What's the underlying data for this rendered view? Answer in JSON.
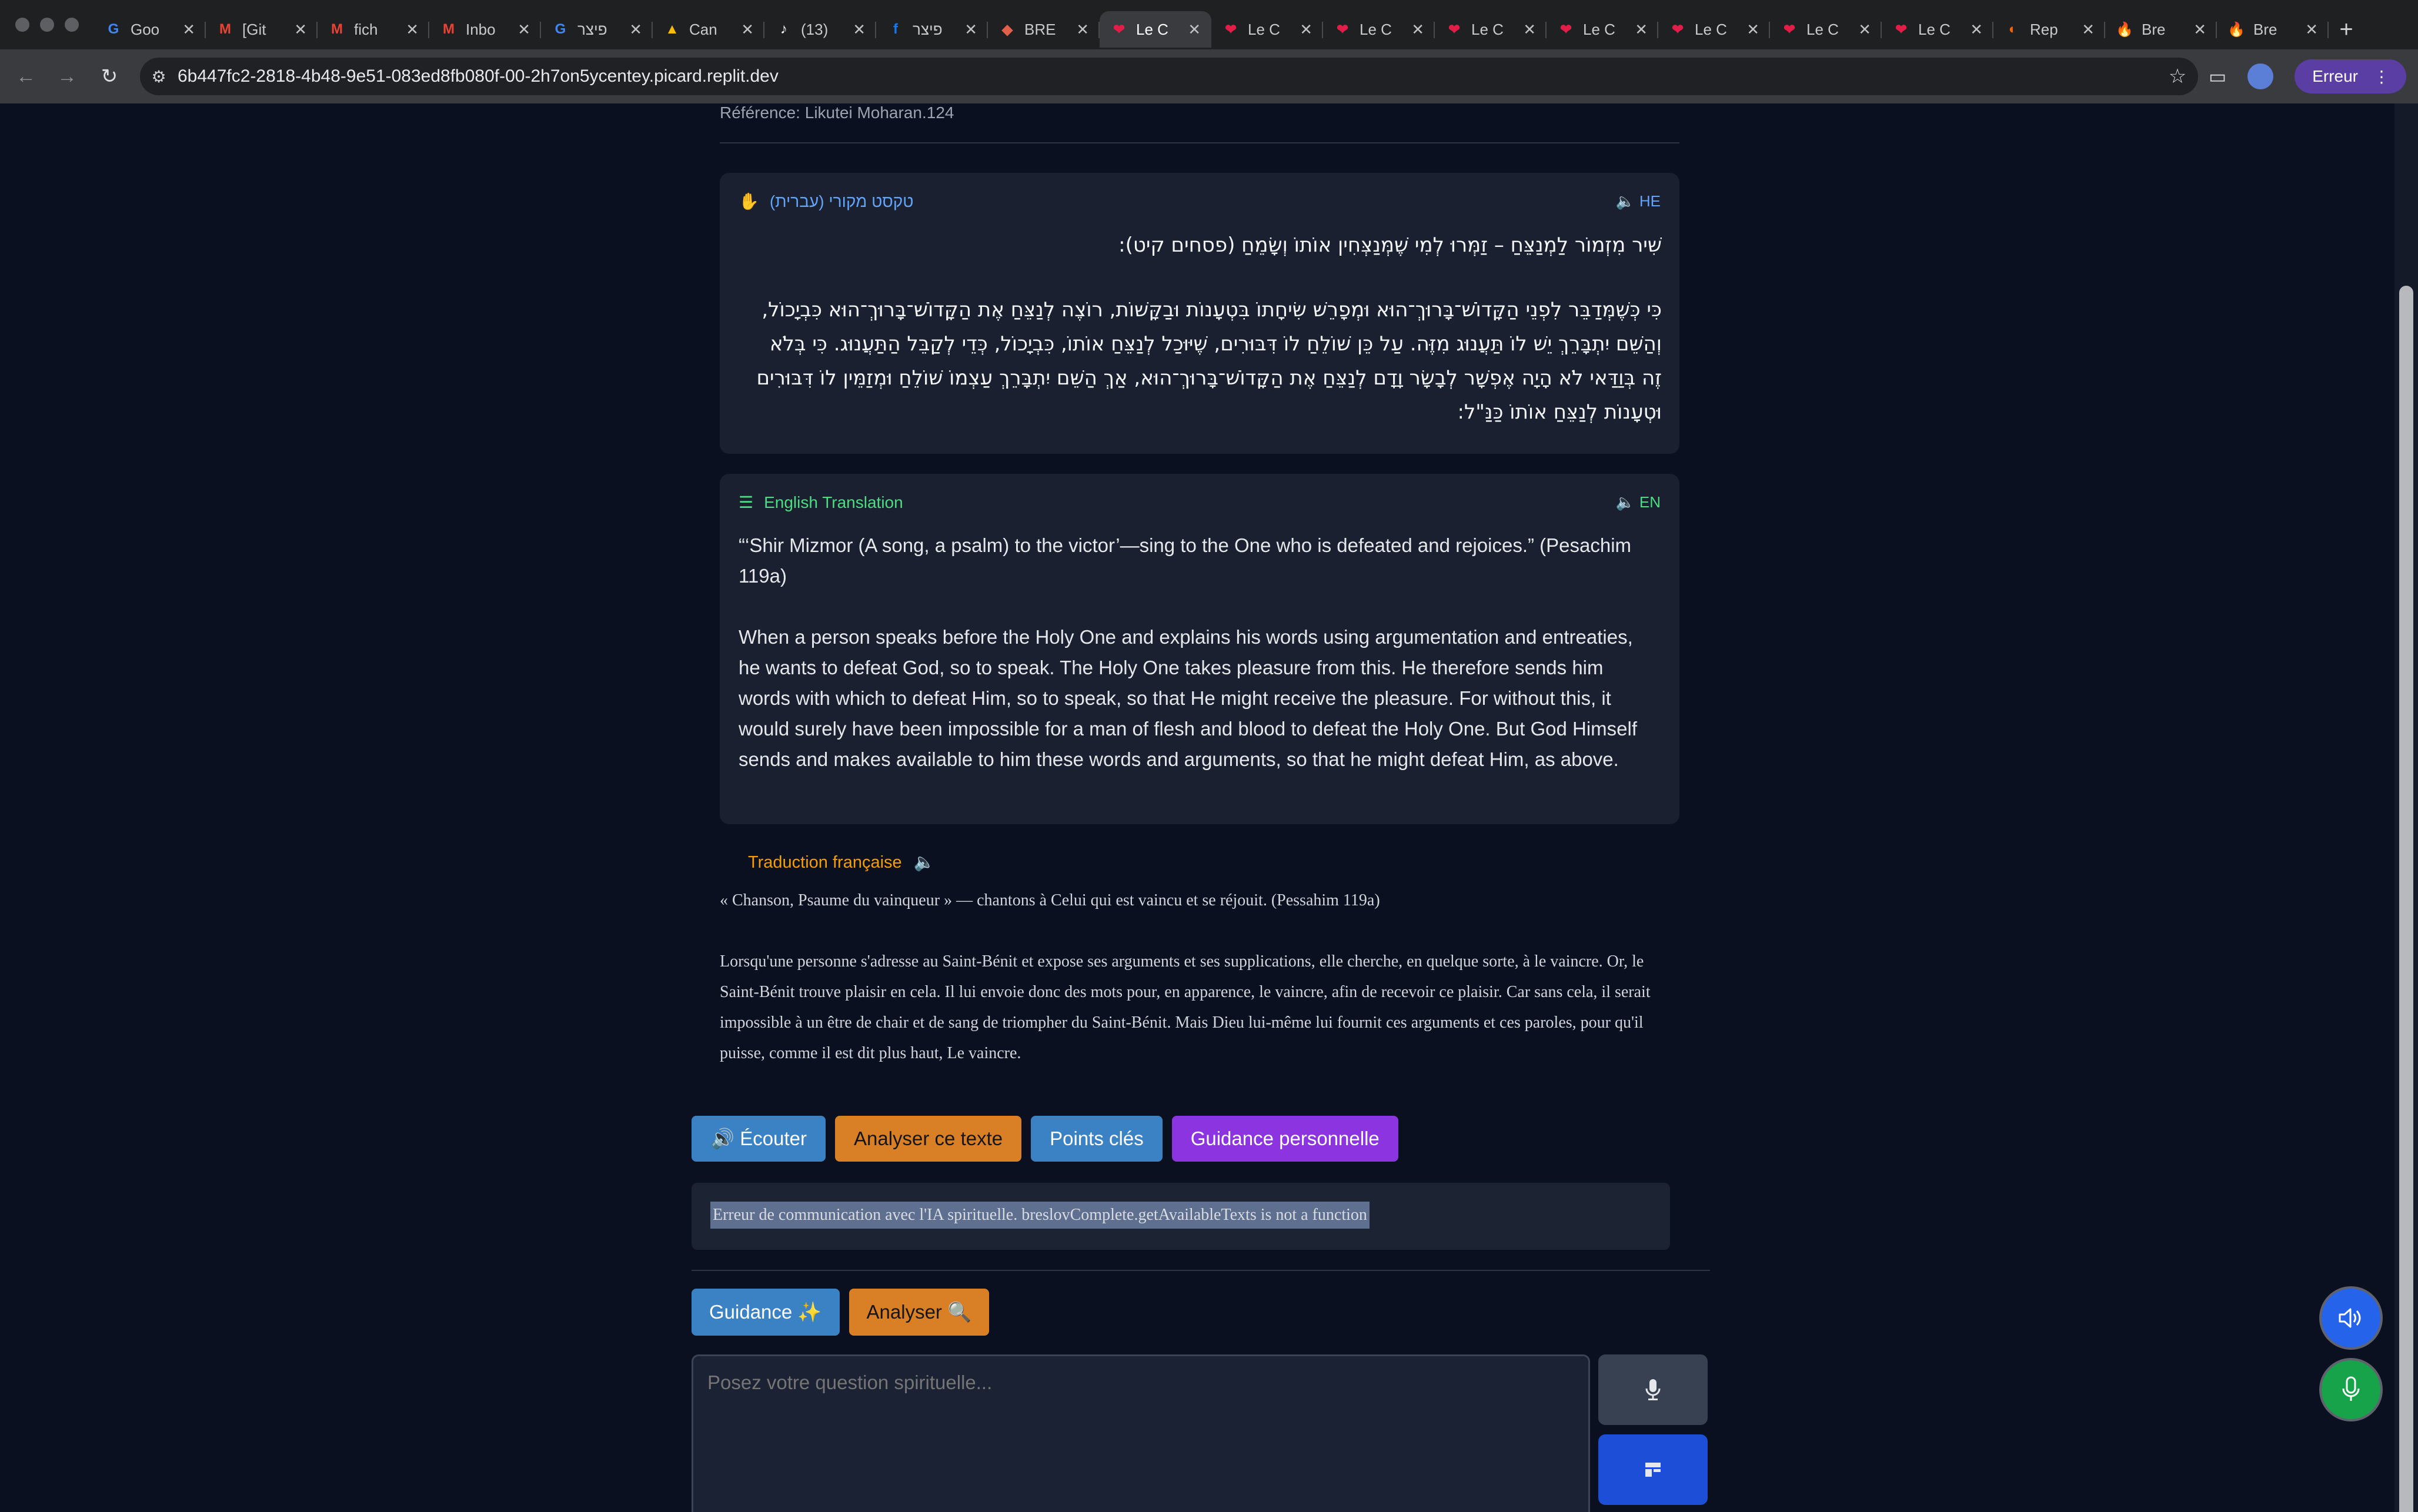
{
  "browser": {
    "tabs": [
      {
        "title": "Goo",
        "icon": "google-icon"
      },
      {
        "title": "[Git",
        "icon": "gmail-icon"
      },
      {
        "title": "fich",
        "icon": "gmail-icon"
      },
      {
        "title": "Inbo",
        "icon": "gmail-icon"
      },
      {
        "title": "פיצר",
        "icon": "google-icon"
      },
      {
        "title": "Can",
        "icon": "drive-icon"
      },
      {
        "title": "(13)",
        "icon": "tiktok-icon"
      },
      {
        "title": "פיצר",
        "icon": "facebook-icon"
      },
      {
        "title": "BRE",
        "icon": "app-icon"
      },
      {
        "title": "Le C",
        "icon": "heart-icon",
        "active": true
      },
      {
        "title": "Le C",
        "icon": "heart-icon"
      },
      {
        "title": "Le C",
        "icon": "heart-icon"
      },
      {
        "title": "Le C",
        "icon": "heart-icon"
      },
      {
        "title": "Le C",
        "icon": "heart-icon"
      },
      {
        "title": "Le C",
        "icon": "heart-icon"
      },
      {
        "title": "Le C",
        "icon": "heart-icon"
      },
      {
        "title": "Le C",
        "icon": "heart-icon"
      },
      {
        "title": "Rep",
        "icon": "replit-icon"
      },
      {
        "title": "Bre",
        "icon": "flame-icon"
      },
      {
        "title": "Bre",
        "icon": "flame-icon"
      }
    ],
    "url": "6b447fc2-2818-4b48-9e51-083ed8fb080f-00-2h7on5ycentey.picard.replit.dev",
    "error_pill": "Erreur"
  },
  "page": {
    "reference": "Référence: Likutei Moharan.124",
    "hebrew": {
      "label": "טקסט מקורי (עברית)",
      "lang": "HE",
      "paragraphs": [
        "שִׁיר מִזְמוֹר לַמְנַצֵּחַ – זַמְּרוּ לְמִי שֶׁמְּנַצְּחִין אוֹתוֹ וְשָׂמֵחַ (פסחים קיט):",
        "כִּי כְּשֶׁמְּדַבֵּר לִפְנֵי הַקָּדוֹשׁ־בָּרוּךְ־הוּא וּמְפָרֵשׁ שִׂיחָתוֹ בִּטְעָנוֹת וּבַקָּשׁוֹת, רוֹצֶה לְנַצֵּחַ אֶת הַקָּדוֹשׁ־בָּרוּךְ־הוּא כִּבְיָכוֹל, וְהַשֵּׁם יִתְבָּרֵךְ יֵשׁ לוֹ תַּעֲנוּג מִזֶּה. עַל כֵּן שׁוֹלֵחַ לוֹ דִּבּוּרִים, שֶׁיּוּכַל לְנַצֵּחַ אוֹתוֹ, כִּבְיָכוֹל, כְּדֵי לְקַבֵּל הַתַּעֲנוּג. כִּי בְּלֹא זֶה בְּוַדַּאי לֹא הָיָה אֶפְשָׁר לְבָשָׂר וָדָם לְנַצֵּחַ אֶת הַקָּדוֹשׁ־בָּרוּךְ־הוּא, אַךְ הַשֵּׁם יִתְבָּרֵךְ עַצְמוֹ שׁוֹלֵחַ וּמְזַמֵּין לוֹ דִּבּוּרִים וּטְעָנוֹת לְנַצֵּחַ אוֹתוֹ כַּנַּ\"ל:"
      ]
    },
    "english": {
      "label": "English Translation",
      "lang": "EN",
      "paragraphs": [
        "“‘Shir Mizmor (A song, a psalm) to the victor’—sing to the One who is defeated and rejoices.” (Pesachim 119a)",
        "When a person speaks before the Holy One and explains his words using argumentation and entreaties, he wants to defeat God, so to speak. The Holy One takes pleasure from this. He therefore sends him words with which to defeat Him, so to speak, so that He might receive the pleasure. For without this, it would surely have been impossible for a man of flesh and blood to defeat the Holy One. But God Himself sends and makes available to him these words and arguments, so that he might defeat Him, as above."
      ]
    },
    "french": {
      "label": "Traduction française",
      "paragraphs": [
        "« Chanson, Psaume du vainqueur » — chantons à Celui qui est vaincu et se réjouit. (Pessahim 119a)",
        "Lorsqu'une personne s'adresse au Saint-Bénit et expose ses arguments et ses supplications, elle cherche, en quelque sorte, à le vaincre.  Or, le Saint-Bénit trouve plaisir en cela. Il lui envoie donc des mots pour, en apparence, le vaincre, afin de recevoir ce plaisir.  Car sans cela, il serait impossible à un être de chair et de sang de triompher du Saint-Bénit.  Mais Dieu lui-même lui fournit ces arguments et ces paroles, pour qu'il puisse, comme il est dit plus haut, Le vaincre."
      ]
    },
    "actions": {
      "listen": "🔊 Écouter",
      "analyze": "Analyser ce texte",
      "key_points": "Points clés",
      "guidance": "Guidance personnelle"
    },
    "error_message": "Erreur de communication avec l'IA spirituelle. breslovComplete.getAvailableTexts is not a function",
    "quick": {
      "guidance": "Guidance ✨",
      "analyze": "Analyser 🔍"
    },
    "question": {
      "placeholder": "Posez votre question spirituelle..."
    }
  },
  "colors": {
    "background": "#0b1020",
    "card": "#1a2030",
    "hebrew_accent": "#60a5fa",
    "english_accent": "#4ade80",
    "french_accent": "#f59e0b",
    "blue_button": "#3b82c4",
    "orange_button": "#d97f26",
    "purple_button": "#8b34e0"
  }
}
